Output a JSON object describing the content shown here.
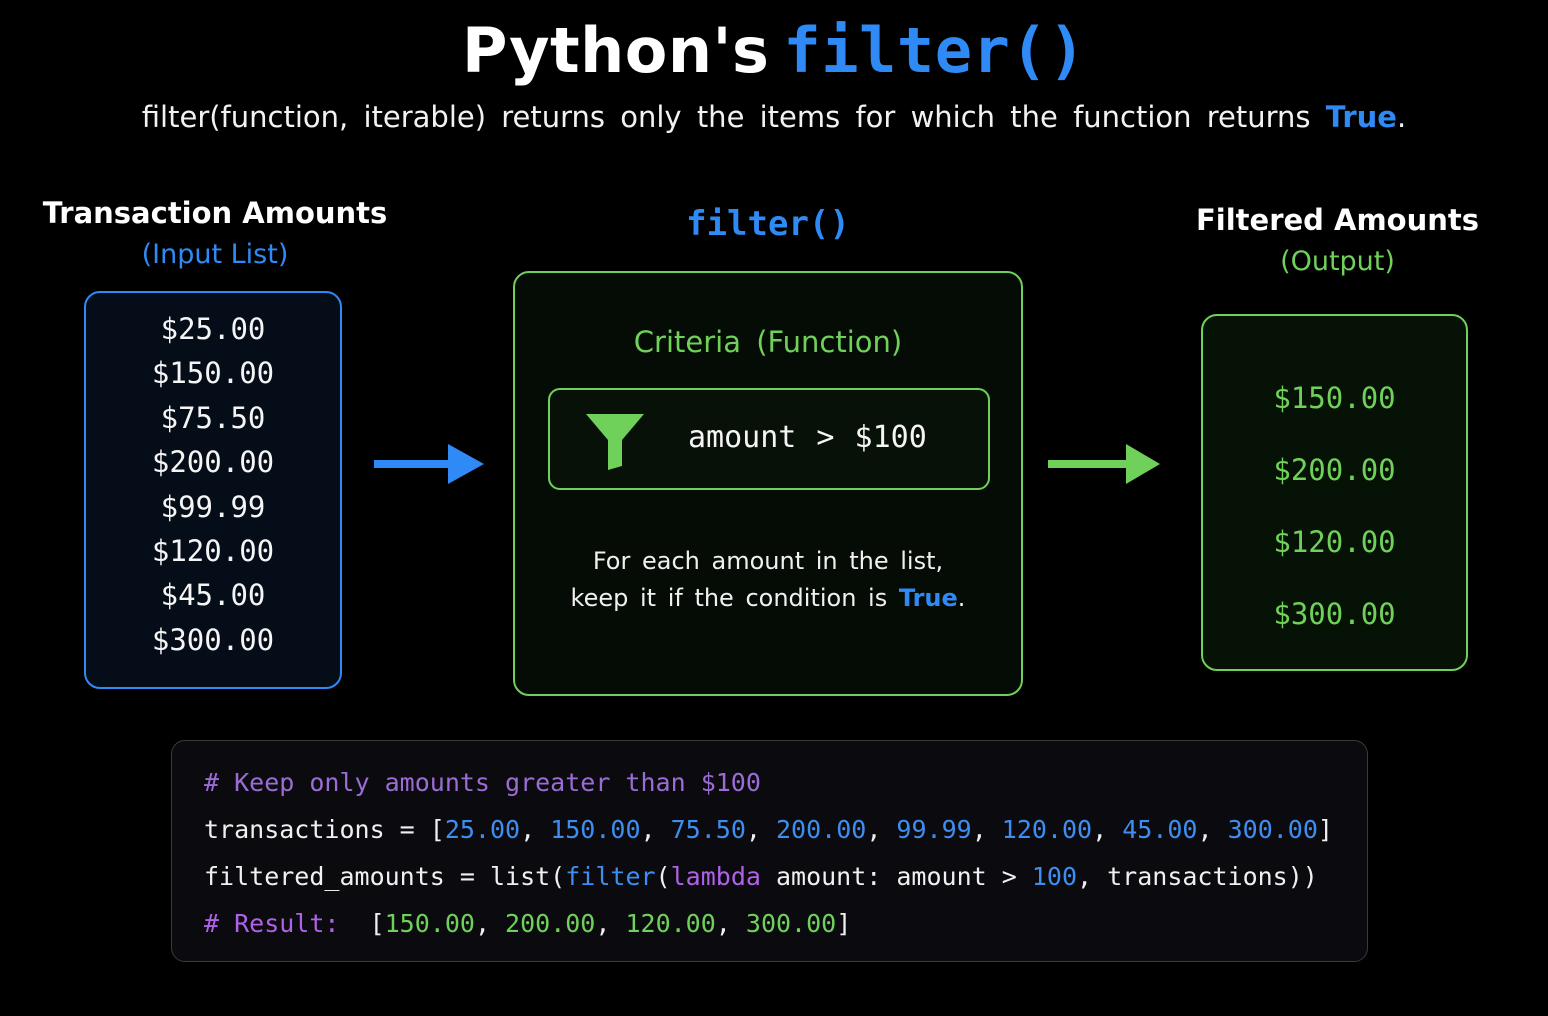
{
  "header": {
    "title_prefix": "Python's",
    "title_func": "filter()",
    "subtitle_main": "filter(function, iterable) returns only the items for which the function returns",
    "subtitle_true": "True",
    "subtitle_end": "."
  },
  "input": {
    "title": "Transaction Amounts",
    "subtitle": "(Input List)",
    "items": [
      "$25.00",
      "$150.00",
      "$75.50",
      "$200.00",
      "$99.99",
      "$120.00",
      "$45.00",
      "$300.00"
    ]
  },
  "filter": {
    "heading": "filter()",
    "criteria_label": "Criteria (Function)",
    "condition": "amount > $100",
    "desc_line1": "For each amount in the list,",
    "desc_line2_prefix": "keep it if the condition is",
    "desc_true": "True",
    "desc_end": "."
  },
  "output": {
    "title": "Filtered Amounts",
    "subtitle": "(Output)",
    "items": [
      "$150.00",
      "$200.00",
      "$120.00",
      "$300.00"
    ]
  },
  "code": {
    "comment": "# Keep only amounts greater than $100",
    "line2_var": "transactions = [",
    "line2_values": [
      "25.00",
      "150.00",
      "75.50",
      "200.00",
      "99.99",
      "120.00",
      "45.00",
      "300.00"
    ],
    "line3_var": "filtered_amounts = list(",
    "line3_func": "filter",
    "line3_kw": "lambda",
    "line3_mid": " amount: amount > ",
    "line3_num": "100",
    "line3_end": ", transactions))",
    "result_label": "# Result:",
    "result_values": [
      "150.00",
      "200.00",
      "120.00",
      "300.00"
    ]
  },
  "colors": {
    "input_accent": "#2f8af5",
    "output_accent": "#6fd15a",
    "background": "#000000"
  },
  "icons": {
    "funnel": "funnel-icon",
    "arrow_in": "arrow-right-icon",
    "arrow_out": "arrow-right-icon"
  }
}
